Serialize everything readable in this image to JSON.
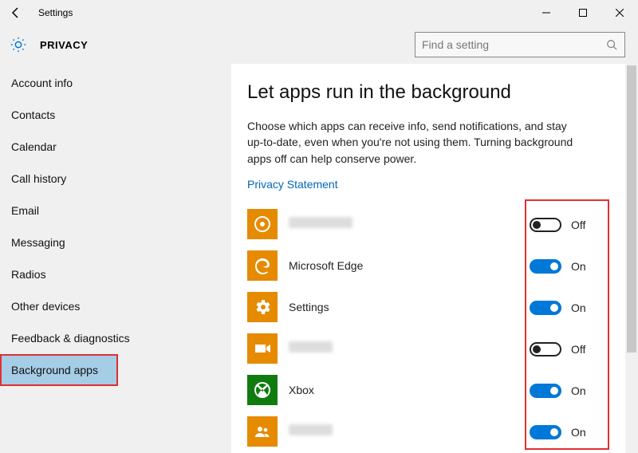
{
  "window": {
    "title": "Settings"
  },
  "header": {
    "pageTitle": "PRIVACY",
    "search": {
      "placeholder": "Find a setting"
    }
  },
  "sidebar": {
    "items": [
      {
        "label": "Account info",
        "selected": false
      },
      {
        "label": "Contacts",
        "selected": false
      },
      {
        "label": "Calendar",
        "selected": false
      },
      {
        "label": "Call history",
        "selected": false
      },
      {
        "label": "Email",
        "selected": false
      },
      {
        "label": "Messaging",
        "selected": false
      },
      {
        "label": "Radios",
        "selected": false
      },
      {
        "label": "Other devices",
        "selected": false
      },
      {
        "label": "Feedback & diagnostics",
        "selected": false
      },
      {
        "label": "Background apps",
        "selected": true
      }
    ]
  },
  "main": {
    "heading": "Let apps run in the background",
    "description": "Choose which apps can receive info, send notifications, and stay up-to-date, even when you're not using them. Turning background apps off can help conserve power.",
    "privacyLink": "Privacy Statement",
    "toggleLabels": {
      "on": "On",
      "off": "Off"
    },
    "apps": [
      {
        "name": "",
        "icon": "target-icon",
        "iconColor": "orange",
        "obscured": true,
        "state": "off"
      },
      {
        "name": "Microsoft Edge",
        "icon": "edge-icon",
        "iconColor": "orange",
        "obscured": false,
        "state": "on"
      },
      {
        "name": "Settings",
        "icon": "gear-icon",
        "iconColor": "orange",
        "obscured": false,
        "state": "on"
      },
      {
        "name": "",
        "icon": "video-icon",
        "iconColor": "orange",
        "obscured": true,
        "state": "off"
      },
      {
        "name": "Xbox",
        "icon": "xbox-icon",
        "iconColor": "green",
        "obscured": false,
        "state": "on"
      },
      {
        "name": "",
        "icon": "people-icon",
        "iconColor": "orange",
        "obscured": true,
        "state": "on"
      }
    ]
  }
}
